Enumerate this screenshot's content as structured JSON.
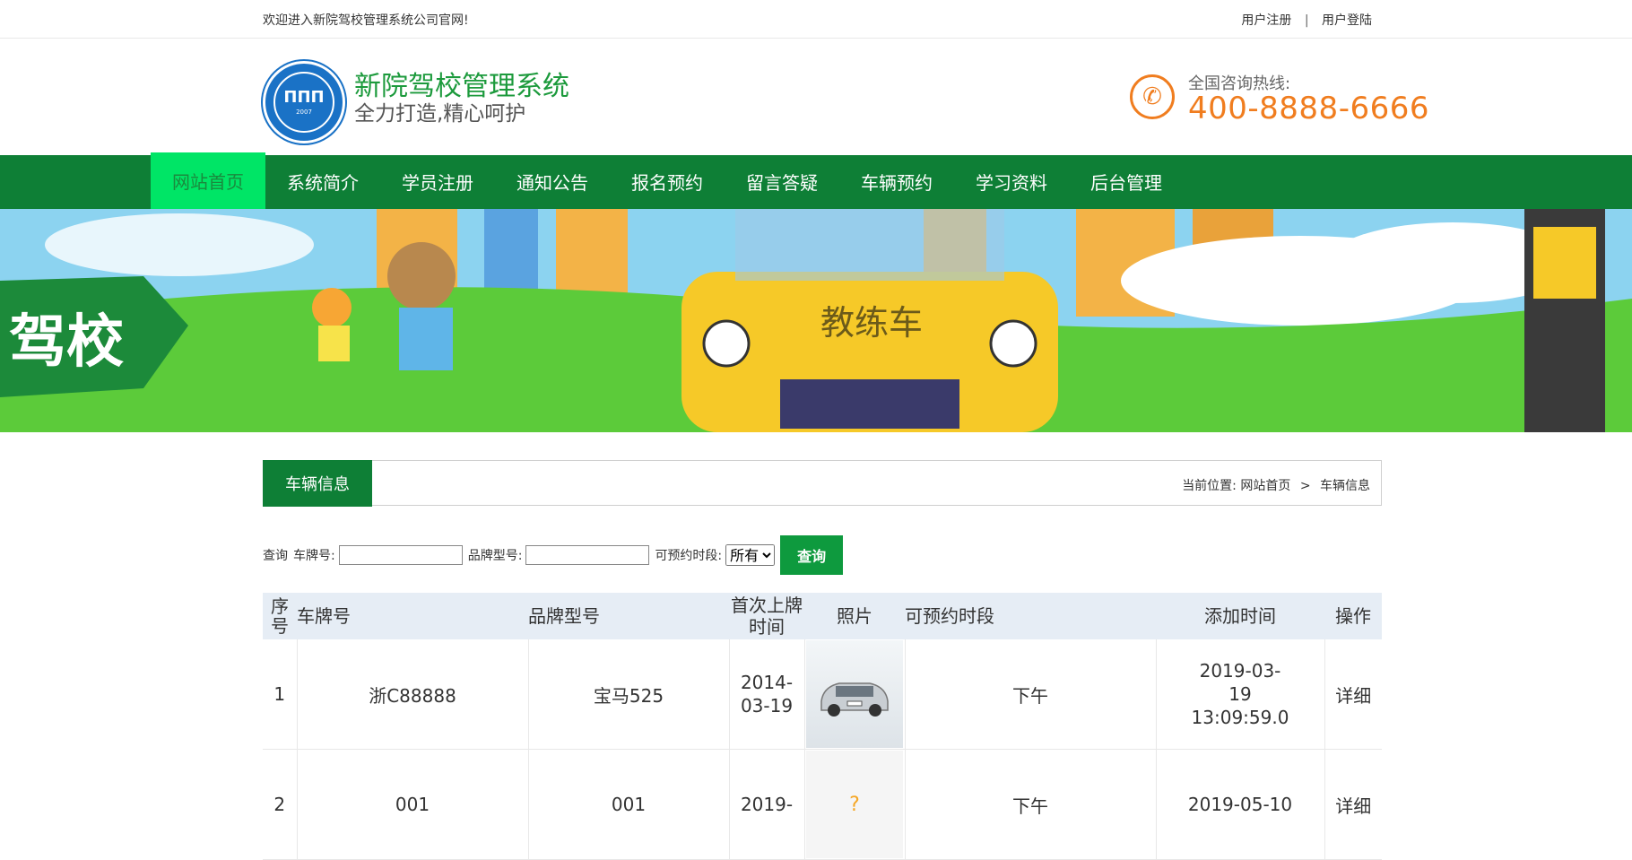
{
  "topbar": {
    "welcome": "欢迎进入新院驾校管理系统公司官网!",
    "register": "用户注册",
    "separator": "|",
    "login": "用户登陆"
  },
  "header": {
    "logo_text": "ΠΠΠ",
    "logo_year": "2007",
    "site_name": "新院驾校管理系统",
    "slogan": "全力打造,精心呵护",
    "hotline_label": "全国咨询热线:",
    "hotline_number": "400-8888-6666"
  },
  "nav": {
    "items": [
      "网站首页",
      "系统简介",
      "学员注册",
      "通知公告",
      "报名预约",
      "留言答疑",
      "车辆预约",
      "学习资料",
      "后台管理"
    ]
  },
  "banner": {
    "left_text": "驾校",
    "car_text": "教练车"
  },
  "section": {
    "title": "车辆信息",
    "breadcrumb_prefix": "当前位置:",
    "breadcrumb_home": "网站首页",
    "breadcrumb_arrow": ">",
    "breadcrumb_current": "车辆信息"
  },
  "search": {
    "label_query": "查询",
    "label_plate": "车牌号:",
    "label_brand": "品牌型号:",
    "label_slot": "可预约时段:",
    "slot_selected": "所有",
    "button": "查询"
  },
  "table": {
    "headers": [
      "序号",
      "车牌号",
      "品牌型号",
      "首次上牌时间",
      "照片",
      "可预约时段",
      "添加时间",
      "操作"
    ],
    "rows": [
      {
        "no": "1",
        "plate": "浙C88888",
        "brand": "宝马525",
        "first_reg": "2014-03-19",
        "photo": "car",
        "slot": "下午",
        "added": "2019-03-19 13:09:59.0",
        "action": "详细"
      },
      {
        "no": "2",
        "plate": "001",
        "brand": "001",
        "first_reg": "2019-",
        "photo": "none",
        "slot": "下午",
        "added": "2019-05-10",
        "action": "详细"
      }
    ]
  },
  "colors": {
    "primary_green": "#0e7f36",
    "nav_active": "#00e566",
    "accent_orange": "#f07d1f",
    "title_green": "#1c9a3c"
  }
}
